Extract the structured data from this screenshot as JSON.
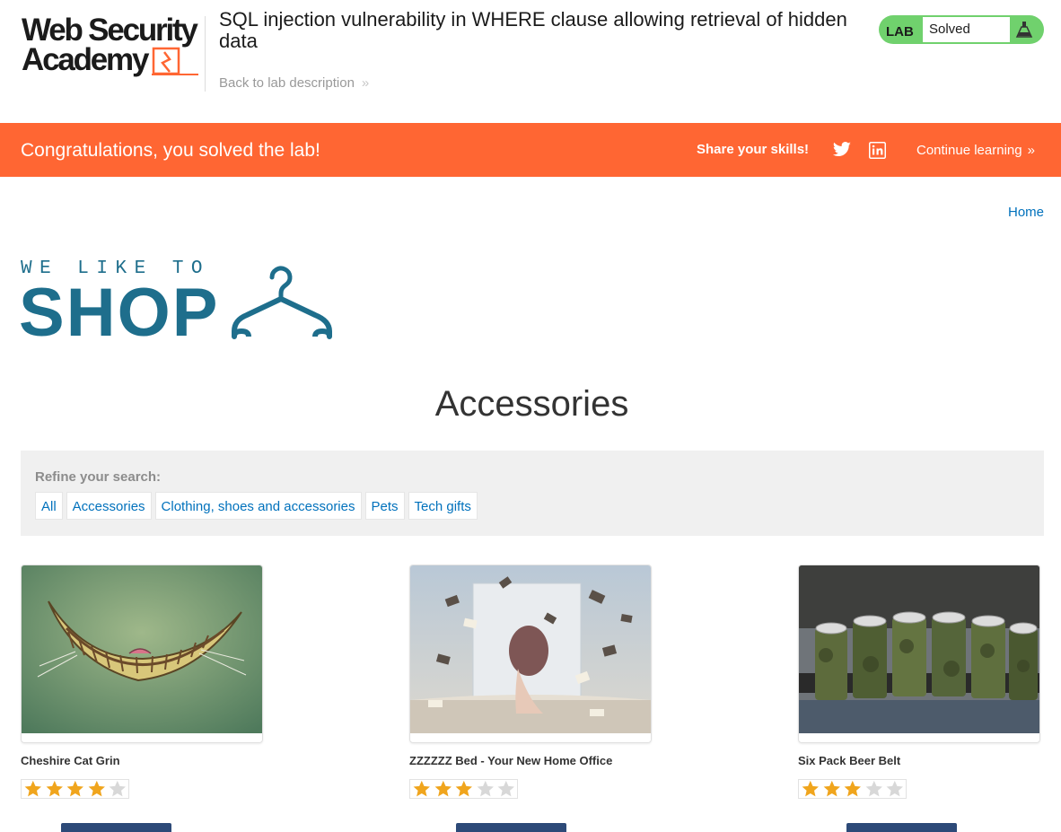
{
  "header": {
    "logo_line1": "Web Security",
    "logo_line2": "Academy",
    "lab_title": "SQL injection vulnerability in WHERE clause allowing retrieval of hidden data",
    "back_link": "Back to lab description",
    "lab_badge": "LAB",
    "lab_status": "Solved",
    "status_color": "#70d16d"
  },
  "banner": {
    "message": "Congratulations, you solved the lab!",
    "share_label": "Share your skills!",
    "continue_label": "Continue learning",
    "color": "#ff6633",
    "icons": [
      "twitter-icon",
      "linkedin-icon"
    ]
  },
  "shop": {
    "home_link": "Home",
    "logo_tagline": "WE LIKE TO",
    "logo_word": "SHOP",
    "page_title": "Accessories",
    "refine_label": "Refine your search:",
    "categories": [
      "All",
      "Accessories",
      "Clothing, shoes and accessories",
      "Pets",
      "Tech gifts"
    ]
  },
  "products": [
    {
      "name": "Cheshire Cat Grin",
      "rating": 4,
      "max_rating": 5,
      "image": "cheshire-cat-grin-image"
    },
    {
      "name": "ZZZZZZ Bed - Your New Home Office",
      "rating": 3,
      "max_rating": 5,
      "image": "bed-flying-books-image"
    },
    {
      "name": "Six Pack Beer Belt",
      "rating": 3,
      "max_rating": 5,
      "image": "beer-belt-image"
    }
  ],
  "colors": {
    "link": "#0071bc",
    "shop_blue": "#1e6e8c",
    "star": "#f0a51d"
  }
}
